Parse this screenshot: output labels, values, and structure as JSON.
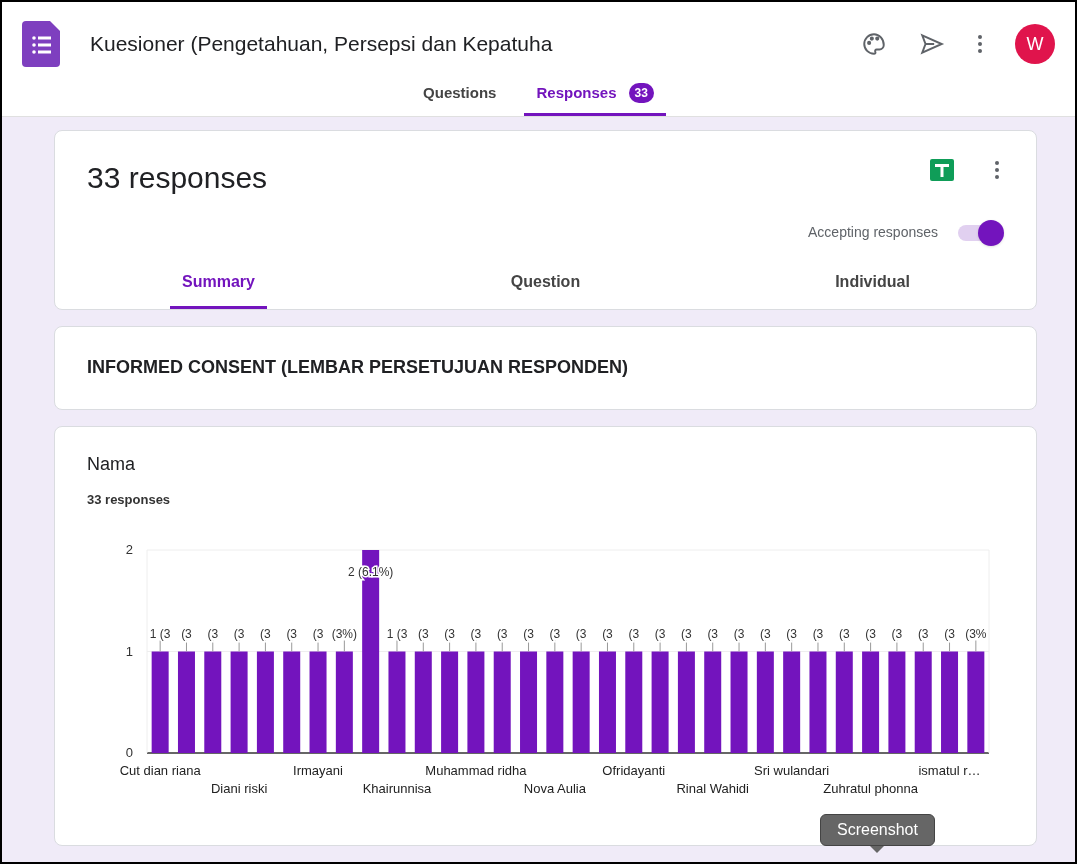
{
  "header": {
    "title": "Kuesioner (Pengetahuan, Persepsi dan Kepatuha",
    "avatar": "W"
  },
  "tabs": [
    {
      "label": "Questions",
      "selected": false
    },
    {
      "label": "Responses",
      "selected": true,
      "badge": "33"
    }
  ],
  "summary_card": {
    "title": "33 responses",
    "accepting_label": "Accepting responses",
    "accepting": true,
    "tabs": [
      {
        "label": "Summary",
        "selected": true
      },
      {
        "label": "Question",
        "selected": false
      },
      {
        "label": "Individual",
        "selected": false
      }
    ]
  },
  "section_card": {
    "title": "INFORMED CONSENT (LEMBAR PERSETUJUAN RESPONDEN)"
  },
  "question_card": {
    "title": "Nama",
    "count": "33 responses",
    "chart_data": {
      "type": "bar",
      "ylim": [
        0,
        2
      ],
      "yticks": [
        0,
        1,
        2
      ],
      "categories": [
        "Cut dian riana",
        null,
        null,
        "Diani riski",
        null,
        null,
        "Irmayani",
        null,
        null,
        "Khairunnisa",
        null,
        null,
        "Muhammad ridha",
        null,
        null,
        "Nova Aulia",
        null,
        null,
        "Ofridayanti",
        null,
        null,
        "Rinal Wahidi",
        null,
        null,
        "Sri wulandari",
        null,
        null,
        "Zuhratul phonna",
        null,
        null,
        "ismatul r…",
        null
      ],
      "series": [
        {
          "color": "#7314bd",
          "values": [
            1,
            1,
            1,
            1,
            1,
            1,
            1,
            1,
            2,
            1,
            1,
            1,
            1,
            1,
            1,
            1,
            1,
            1,
            1,
            1,
            1,
            1,
            1,
            1,
            1,
            1,
            1,
            1,
            1,
            1,
            1,
            1
          ]
        }
      ],
      "value_labels": [
        "1 (3",
        "(3",
        "(3",
        "(3",
        "(3",
        "(3",
        "(3",
        "(3%)",
        "2 (6.1%)",
        "1 (3",
        "(3",
        "(3",
        "(3",
        "(3",
        "(3",
        "(3",
        "(3",
        "(3",
        "(3",
        "(3",
        "(3",
        "(3",
        "(3",
        "(3",
        "(3",
        "(3",
        "(3",
        "(3",
        "(3",
        "(3",
        "(3",
        "(3%"
      ]
    }
  },
  "tooltip": "Screenshot"
}
